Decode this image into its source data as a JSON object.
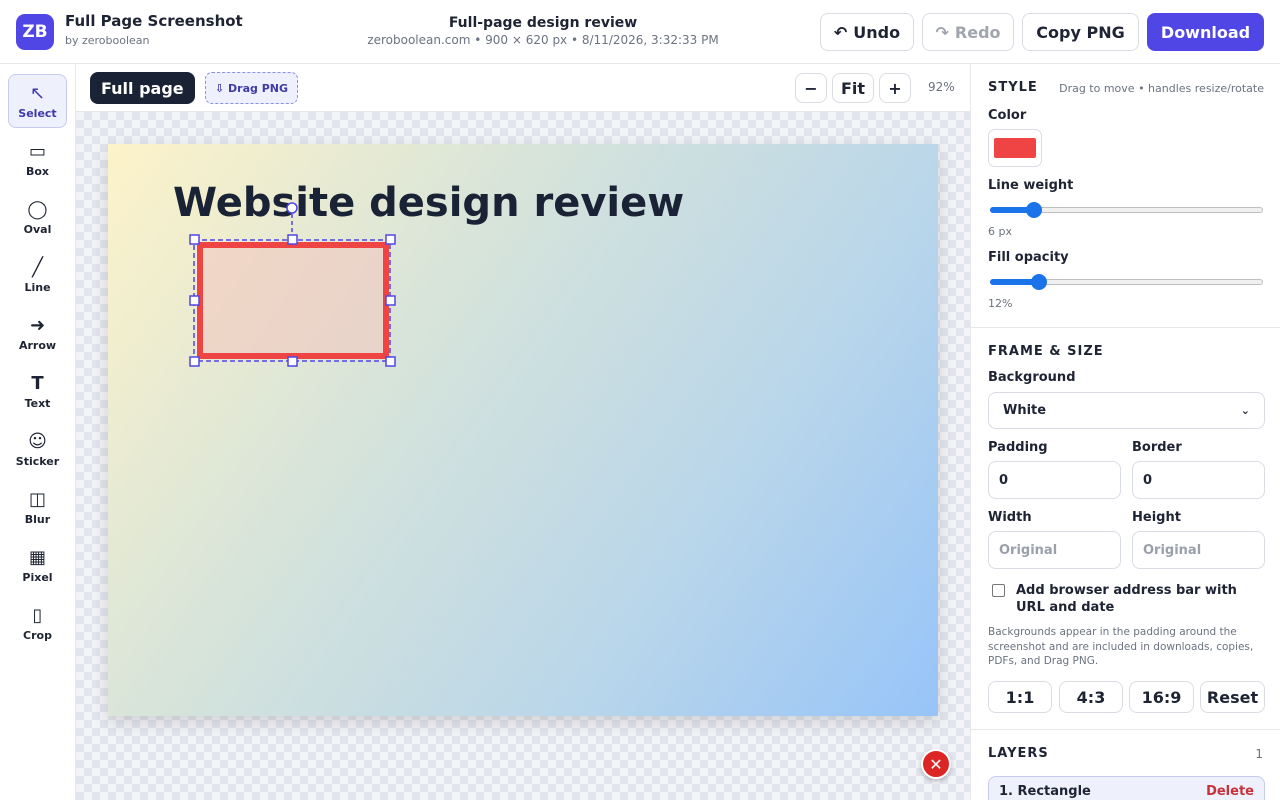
{
  "header": {
    "logo_text": "ZB",
    "app_title": "Full Page Screenshot",
    "app_subtitle": "by zeroboolean",
    "doc_title": "Full-page design review",
    "doc_meta": "zeroboolean.com • 900 × 620 px • 8/11/2026, 3:32:33 PM",
    "undo_label": "Undo",
    "redo_label": "Redo",
    "copy_label": "Copy PNG",
    "download_label": "Download"
  },
  "toolbar": {
    "tools": [
      {
        "label": "Select",
        "icon": "cursor-icon",
        "glyph": "↖",
        "active": true
      },
      {
        "label": "Box",
        "icon": "box-icon",
        "glyph": "▭"
      },
      {
        "label": "Oval",
        "icon": "oval-icon",
        "glyph": "◯"
      },
      {
        "label": "Line",
        "icon": "line-icon",
        "glyph": "╱"
      },
      {
        "label": "Arrow",
        "icon": "arrow-icon",
        "glyph": "➜"
      },
      {
        "label": "Text",
        "icon": "text-icon",
        "glyph": "T"
      },
      {
        "label": "Sticker",
        "icon": "sticker-icon",
        "glyph": "☺"
      },
      {
        "label": "Blur",
        "icon": "blur-icon",
        "glyph": "◫"
      },
      {
        "label": "Pixel",
        "icon": "pixel-icon",
        "glyph": "▦"
      },
      {
        "label": "Crop",
        "icon": "crop-icon",
        "glyph": "▯"
      }
    ]
  },
  "canvas": {
    "view_label": "Full page",
    "drag_png_label": "Drag PNG",
    "zoom_out": "−",
    "fit_label": "Fit",
    "zoom_in": "+",
    "zoom_level": "92%",
    "page_heading": "Website design review"
  },
  "style_panel": {
    "title": "STYLE",
    "hint": "Drag to move • handles resize/rotate",
    "color_label": "Color",
    "color_value": "#ef4444",
    "line_weight_label": "Line weight",
    "line_weight_value": "6 px",
    "line_weight_fraction": 0.16,
    "fill_opacity_label": "Fill opacity",
    "fill_opacity_value": "12%",
    "fill_opacity_fraction": 0.18
  },
  "frame_panel": {
    "title": "FRAME & SIZE",
    "background_label": "Background",
    "background_value": "White",
    "padding_label": "Padding",
    "padding_value": "0",
    "border_label": "Border",
    "border_value": "0",
    "width_label": "Width",
    "width_placeholder": "Original",
    "height_label": "Height",
    "height_placeholder": "Original",
    "address_bar_label": "Add browser address bar with URL and date",
    "note": "Backgrounds appear in the padding around the screenshot and are included in downloads, copies, PDFs, and Drag PNG.",
    "ratios": [
      "1:1",
      "4:3",
      "16:9"
    ],
    "reset_label": "Reset"
  },
  "layers_panel": {
    "title": "LAYERS",
    "count": "1",
    "items": [
      {
        "name": "1. Rectangle",
        "delete_label": "Delete"
      }
    ]
  }
}
